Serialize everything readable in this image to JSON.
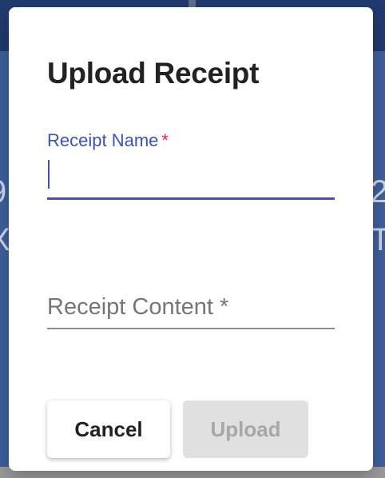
{
  "background": {
    "fragments": [
      "9",
      "X",
      "2",
      "T"
    ]
  },
  "dialog": {
    "title": "Upload Receipt",
    "fields": {
      "receipt_name": {
        "label": "Receipt Name",
        "required_mark": "*",
        "value": ""
      },
      "receipt_content": {
        "label": "Receipt Content *"
      }
    },
    "buttons": {
      "cancel": "Cancel",
      "upload": "Upload"
    }
  },
  "colors": {
    "accent": "#3f51b5",
    "required": "#e91e63",
    "disabled_bg": "#e0e0e0",
    "disabled_text": "#a7a7a7",
    "backdrop": "#3f5f9d"
  }
}
